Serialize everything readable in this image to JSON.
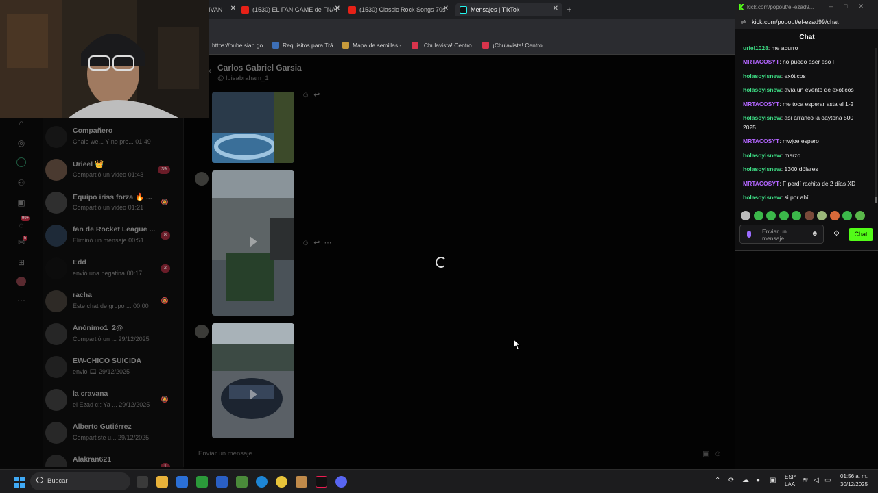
{
  "browser": {
    "tabs": [
      {
        "label": "IVAN",
        "icon": "twitch-icon"
      },
      {
        "label": "(1530) EL FAN GAME de FNAF",
        "icon": "youtube-icon"
      },
      {
        "label": "(1530) Classic Rock Songs 70s",
        "icon": "youtube-icon"
      },
      {
        "label": "Mensajes | TikTok",
        "icon": "tiktok-icon",
        "active": true
      }
    ],
    "new_tab": "+",
    "bookmarks": [
      "https://nube.siap.go...",
      "Requisitos para Trá...",
      "Mapa de semillas -...",
      "¡Chulavista! Centro...",
      "¡Chulavista! Centro..."
    ]
  },
  "tiktok": {
    "chat_name": "Carlos Gabriel Garsia",
    "chat_username": "@ luisabraham_1",
    "composer_placeholder": "Enviar un mensaje...",
    "conversations": [
      {
        "name": "Compañero",
        "preview": "Chale we... Y no pre...",
        "time": "01:49",
        "badge": ""
      },
      {
        "name": "Urieel 👑",
        "preview": "Compartió un video",
        "time": "01:43",
        "badge": "39"
      },
      {
        "name": "Equipo iriss forza 🔥 ...",
        "preview": "Compartió un video",
        "time": "01:21",
        "badge": "",
        "muted": true
      },
      {
        "name": "fan de Rocket League ...",
        "preview": "Eliminó un mensaje",
        "time": "00:51",
        "badge": "8"
      },
      {
        "name": "Edd",
        "preview": "envió una pegatina",
        "time": "00:17",
        "badge": "2"
      },
      {
        "name": "racha",
        "preview": "Este chat de grupo ...",
        "time": "00:00",
        "badge": "",
        "muted": true
      },
      {
        "name": "Anónimo1_2@",
        "preview": "Compartió un ...",
        "time": "29/12/2025",
        "badge": ""
      },
      {
        "name": "EW-CHICO SUICIDA",
        "preview": "envió 🎞",
        "time": "29/12/2025",
        "badge": ""
      },
      {
        "name": "la cravana",
        "preview": "el Ezad c:: Ya ...",
        "time": "29/12/2025",
        "badge": "",
        "muted": true
      },
      {
        "name": "Alberto Gutiérrez",
        "preview": "Compartiste u...",
        "time": "29/12/2025",
        "badge": ""
      },
      {
        "name": "Alakran621",
        "preview": "",
        "time": "",
        "badge": "1"
      }
    ],
    "rail_badges": [
      "99+",
      "5"
    ]
  },
  "kick": {
    "window_title": "kick.com/popout/el-ezad9...",
    "url": "kick.com/popout/el-ezad99/chat",
    "header": "Chat",
    "messages": [
      {
        "user": "uriel1028",
        "text": "me aburro",
        "color": "green"
      },
      {
        "user": "MRTACOSYT",
        "text": "no puedo aser eso F",
        "color": "purple"
      },
      {
        "user": "holasoyisnew",
        "text": "exóticos",
        "color": "green"
      },
      {
        "user": "holasoyisnew",
        "text": "avía un evento de exóticos",
        "color": "green"
      },
      {
        "user": "MRTACOSYT",
        "text": "me toca esperar asta el 1-2",
        "color": "purple"
      },
      {
        "user": "holasoyisnew",
        "text": "así arranco la daytona 500 2025",
        "color": "green"
      },
      {
        "user": "MRTACOSYT",
        "text": "mwjoe espero",
        "color": "purple"
      },
      {
        "user": "holasoyisnew",
        "text": "marzo",
        "color": "green"
      },
      {
        "user": "holasoyisnew",
        "text": "1300 dólares",
        "color": "green"
      },
      {
        "user": "MRTACOSYT",
        "text": "F perdí rachita de 2 días XD",
        "color": "purple"
      },
      {
        "user": "holasoyisnew",
        "text": "si por ahí",
        "color": "green"
      }
    ],
    "input_placeholder": "Enviar un mensaje",
    "send_label": "Chat"
  },
  "taskbar": {
    "search_placeholder": "Buscar",
    "language_line1": "ESP",
    "language_line2": "LAA",
    "time": "01:56 a. m.",
    "date": "30/12/2025"
  },
  "colors": {
    "kick_green": "#53fc18",
    "user_green": "#3ddc84",
    "user_purple": "#b366ff"
  }
}
